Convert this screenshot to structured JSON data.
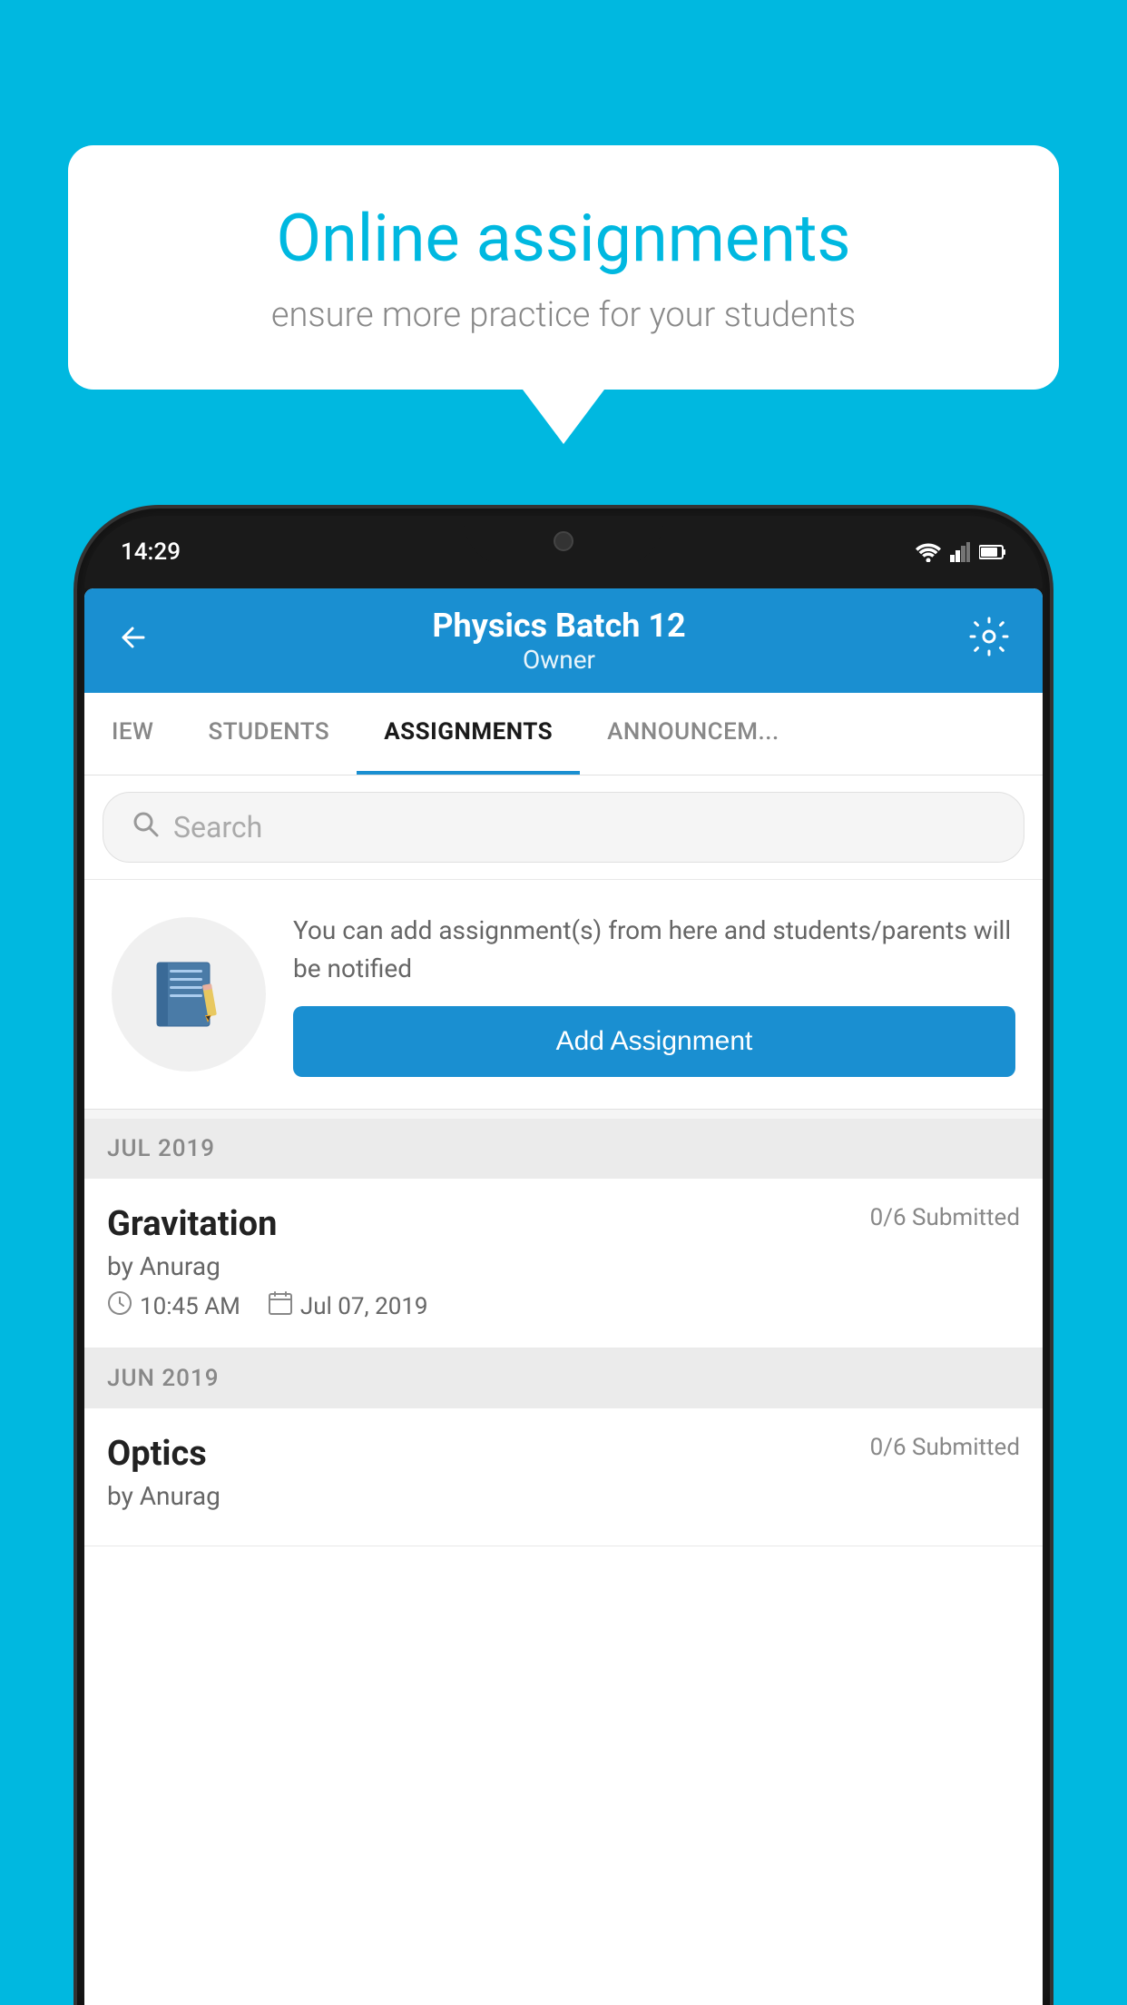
{
  "background_color": "#00b8e0",
  "speech_bubble": {
    "title": "Online assignments",
    "subtitle": "ensure more practice for your students"
  },
  "status_bar": {
    "time": "14:29"
  },
  "header": {
    "title": "Physics Batch 12",
    "subtitle": "Owner"
  },
  "tabs": [
    {
      "id": "view",
      "label": "IEW",
      "active": false
    },
    {
      "id": "students",
      "label": "STUDENTS",
      "active": false
    },
    {
      "id": "assignments",
      "label": "ASSIGNMENTS",
      "active": true
    },
    {
      "id": "announcements",
      "label": "ANNOUNCEM...",
      "active": false
    }
  ],
  "search": {
    "placeholder": "Search"
  },
  "promo": {
    "description": "You can add assignment(s) from here and students/parents will be notified",
    "button_label": "Add Assignment"
  },
  "sections": [
    {
      "label": "JUL 2019",
      "assignments": [
        {
          "name": "Gravitation",
          "submitted": "0/6 Submitted",
          "by": "by Anurag",
          "time": "10:45 AM",
          "date": "Jul 07, 2019"
        }
      ]
    },
    {
      "label": "JUN 2019",
      "assignments": [
        {
          "name": "Optics",
          "submitted": "0/6 Submitted",
          "by": "by Anurag",
          "time": "",
          "date": ""
        }
      ]
    }
  ]
}
